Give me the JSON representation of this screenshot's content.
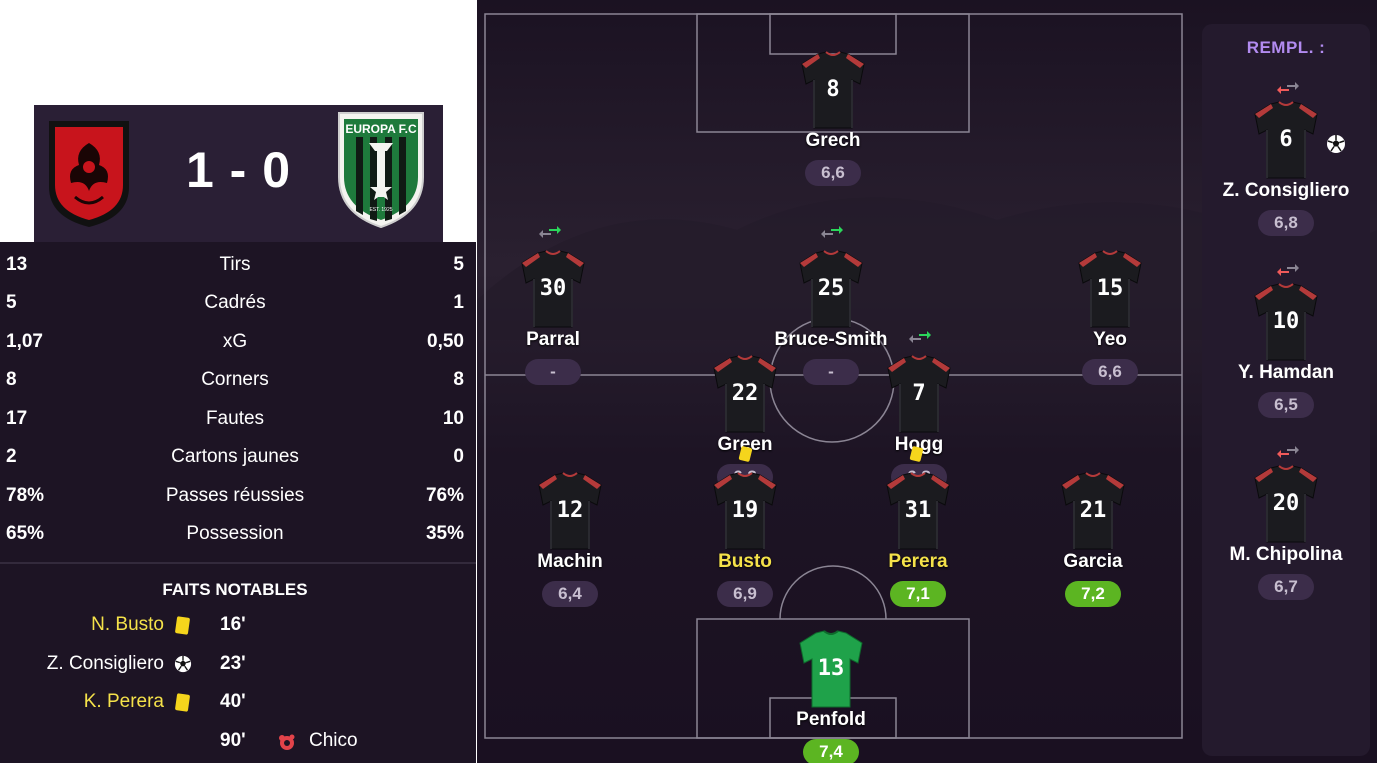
{
  "scoreboard": {
    "score": "1 - 0",
    "home_crest": "red-dragon-crest",
    "away_crest": "europa-fc-crest",
    "away_crest_text": "EUROPA F.C",
    "away_crest_est": "EST. 1925"
  },
  "stats": [
    {
      "home": "13",
      "label": "Tirs",
      "away": "5"
    },
    {
      "home": "5",
      "label": "Cadrés",
      "away": "1"
    },
    {
      "home": "1,07",
      "label": "xG",
      "away": "0,50"
    },
    {
      "home": "8",
      "label": "Corners",
      "away": "8"
    },
    {
      "home": "17",
      "label": "Fautes",
      "away": "10"
    },
    {
      "home": "2",
      "label": "Cartons jaunes",
      "away": "0"
    },
    {
      "home": "78%",
      "label": "Passes réussies",
      "away": "76%"
    },
    {
      "home": "65%",
      "label": "Possession",
      "away": "35%"
    }
  ],
  "facts": {
    "title": "FAITS NOTABLES",
    "items": [
      {
        "player": "N. Busto",
        "icon": "yellow-card-icon",
        "minute": "16'",
        "other": ""
      },
      {
        "player": "Z. Consigliero",
        "icon": "football-icon",
        "minute": "23'",
        "other": ""
      },
      {
        "player": "K. Perera",
        "icon": "yellow-card-icon",
        "minute": "40'",
        "other": ""
      },
      {
        "player": "",
        "icon": "injury-icon",
        "minute": "90'",
        "other": "Chico"
      }
    ]
  },
  "pitch": {
    "players": [
      {
        "number": "8",
        "name": "Grech",
        "rating": "6,6"
      },
      {
        "number": "30",
        "name": "Parral",
        "rating": "-"
      },
      {
        "number": "25",
        "name": "Bruce-Smith",
        "rating": "-"
      },
      {
        "number": "15",
        "name": "Yeo",
        "rating": "6,6"
      },
      {
        "number": "22",
        "name": "Green",
        "rating": "6,3"
      },
      {
        "number": "7",
        "name": "Hogg",
        "rating": "6,8"
      },
      {
        "number": "12",
        "name": "Machin",
        "rating": "6,4"
      },
      {
        "number": "19",
        "name": "Busto",
        "rating": "6,9"
      },
      {
        "number": "31",
        "name": "Perera",
        "rating": "7,1"
      },
      {
        "number": "21",
        "name": "Garcia",
        "rating": "7,2"
      },
      {
        "number": "13",
        "name": "Penfold",
        "rating": "7,4"
      }
    ]
  },
  "subs": {
    "title": "REMPL. :",
    "players": [
      {
        "number": "6",
        "name": "Z. Consigliero",
        "rating": "6,8"
      },
      {
        "number": "10",
        "name": "Y. Hamdan",
        "rating": "6,5"
      },
      {
        "number": "20",
        "name": "M. Chipolina",
        "rating": "6,7"
      }
    ]
  },
  "colors": {
    "panel": "#1d1424",
    "highlight": "#f5e24a",
    "good_rating": "#5cb522",
    "subs_title": "#b28bf0",
    "swap_in": "#2bd65b",
    "swap_out": "#f05a5a"
  }
}
